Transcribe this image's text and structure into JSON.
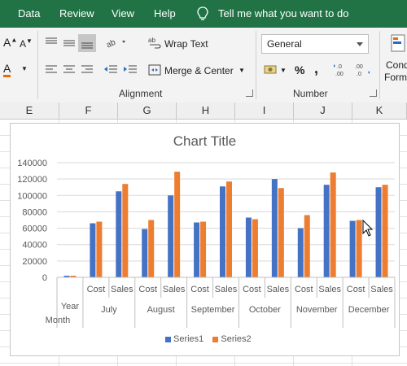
{
  "ribbon": {
    "tabs": [
      "Data",
      "Review",
      "View",
      "Help"
    ],
    "tell_me": "Tell me what you want to do",
    "wrap_text": "Wrap Text",
    "merge_center": "Merge & Center",
    "number_format": "General",
    "percent": "%",
    "comma": ",",
    "alignment_label": "Alignment",
    "number_label": "Number",
    "cond_format_line1": "Cond",
    "cond_format_line2": "Form"
  },
  "columns": [
    "E",
    "F",
    "G",
    "H",
    "I",
    "J",
    "K"
  ],
  "colors": {
    "ribbon_green": "#217346",
    "series1": "#4472C4",
    "series2": "#ED7D31"
  },
  "chart_data": {
    "type": "bar",
    "title": "Chart Title",
    "ylim": [
      0,
      140000
    ],
    "yticks": [
      0,
      20000,
      40000,
      60000,
      80000,
      100000,
      120000,
      140000
    ],
    "ytick_labels": [
      "0",
      "20000",
      "40000",
      "60000",
      "80000",
      "100000",
      "120000",
      "140000"
    ],
    "categories": [
      "Year|Month",
      "July|Cost",
      "July|Sales",
      "August|Cost",
      "August|Sales",
      "September|Cost",
      "September|Sales",
      "October|Cost",
      "October|Sales",
      "November|Cost",
      "November|Sales",
      "December|Cost",
      "December|Sales"
    ],
    "inner_labels": [
      "Year",
      "Cost",
      "Sales",
      "Cost",
      "Sales",
      "Cost",
      "Sales",
      "Cost",
      "Sales",
      "Cost",
      "Sales",
      "Cost",
      "Sales"
    ],
    "outer_labels": [
      "Month",
      "July",
      "August",
      "September",
      "October",
      "November",
      "December"
    ],
    "series": [
      {
        "name": "Series1",
        "values": [
          2000,
          66000,
          105000,
          59000,
          100000,
          67000,
          111000,
          73000,
          120000,
          60000,
          113000,
          69000,
          110000
        ]
      },
      {
        "name": "Series2",
        "values": [
          2000,
          68000,
          114000,
          70000,
          129000,
          68000,
          117000,
          71000,
          109000,
          76000,
          128000,
          70000,
          113000
        ]
      }
    ],
    "legend_position": "bottom",
    "grid": true
  }
}
